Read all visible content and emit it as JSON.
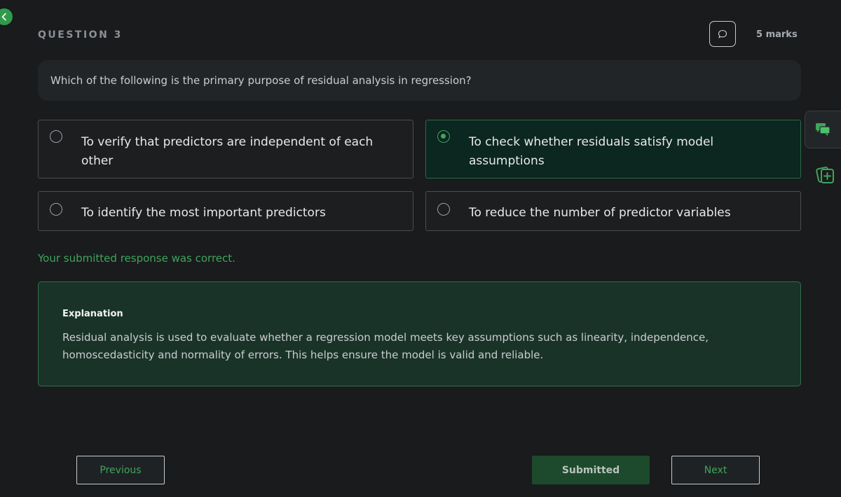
{
  "question": {
    "label": "QUESTION 3",
    "marks": "5 marks",
    "text": "Which of the following is the primary purpose of residual analysis in regression?"
  },
  "options": [
    {
      "text": "To verify that predictors are independent of each other",
      "selected": false
    },
    {
      "text": "To check whether residuals satisfy model assumptions",
      "selected": true
    },
    {
      "text": "To identify the most important predictors",
      "selected": false
    },
    {
      "text": "To reduce the number of predictor variables",
      "selected": false
    }
  ],
  "feedback": "Your submitted response was correct.",
  "explanation": {
    "title": "Explanation",
    "body": "Residual analysis is used to evaluate whether a regression model meets key assumptions such as linearity, independence, homoscedasticity and normality of errors. This helps ensure the model is valid and reliable."
  },
  "nav": {
    "previous": "Previous",
    "submitted": "Submitted",
    "next": "Next"
  },
  "icons": {
    "back": "chevron-left-icon",
    "comment": "speech-bubble-icon",
    "chat": "chat-icon",
    "add_card": "add-card-icon"
  },
  "colors": {
    "accent": "#3fa55c",
    "background": "#191b1d",
    "selected_option": "#0c2620",
    "explanation_bg": "#1a3328"
  }
}
